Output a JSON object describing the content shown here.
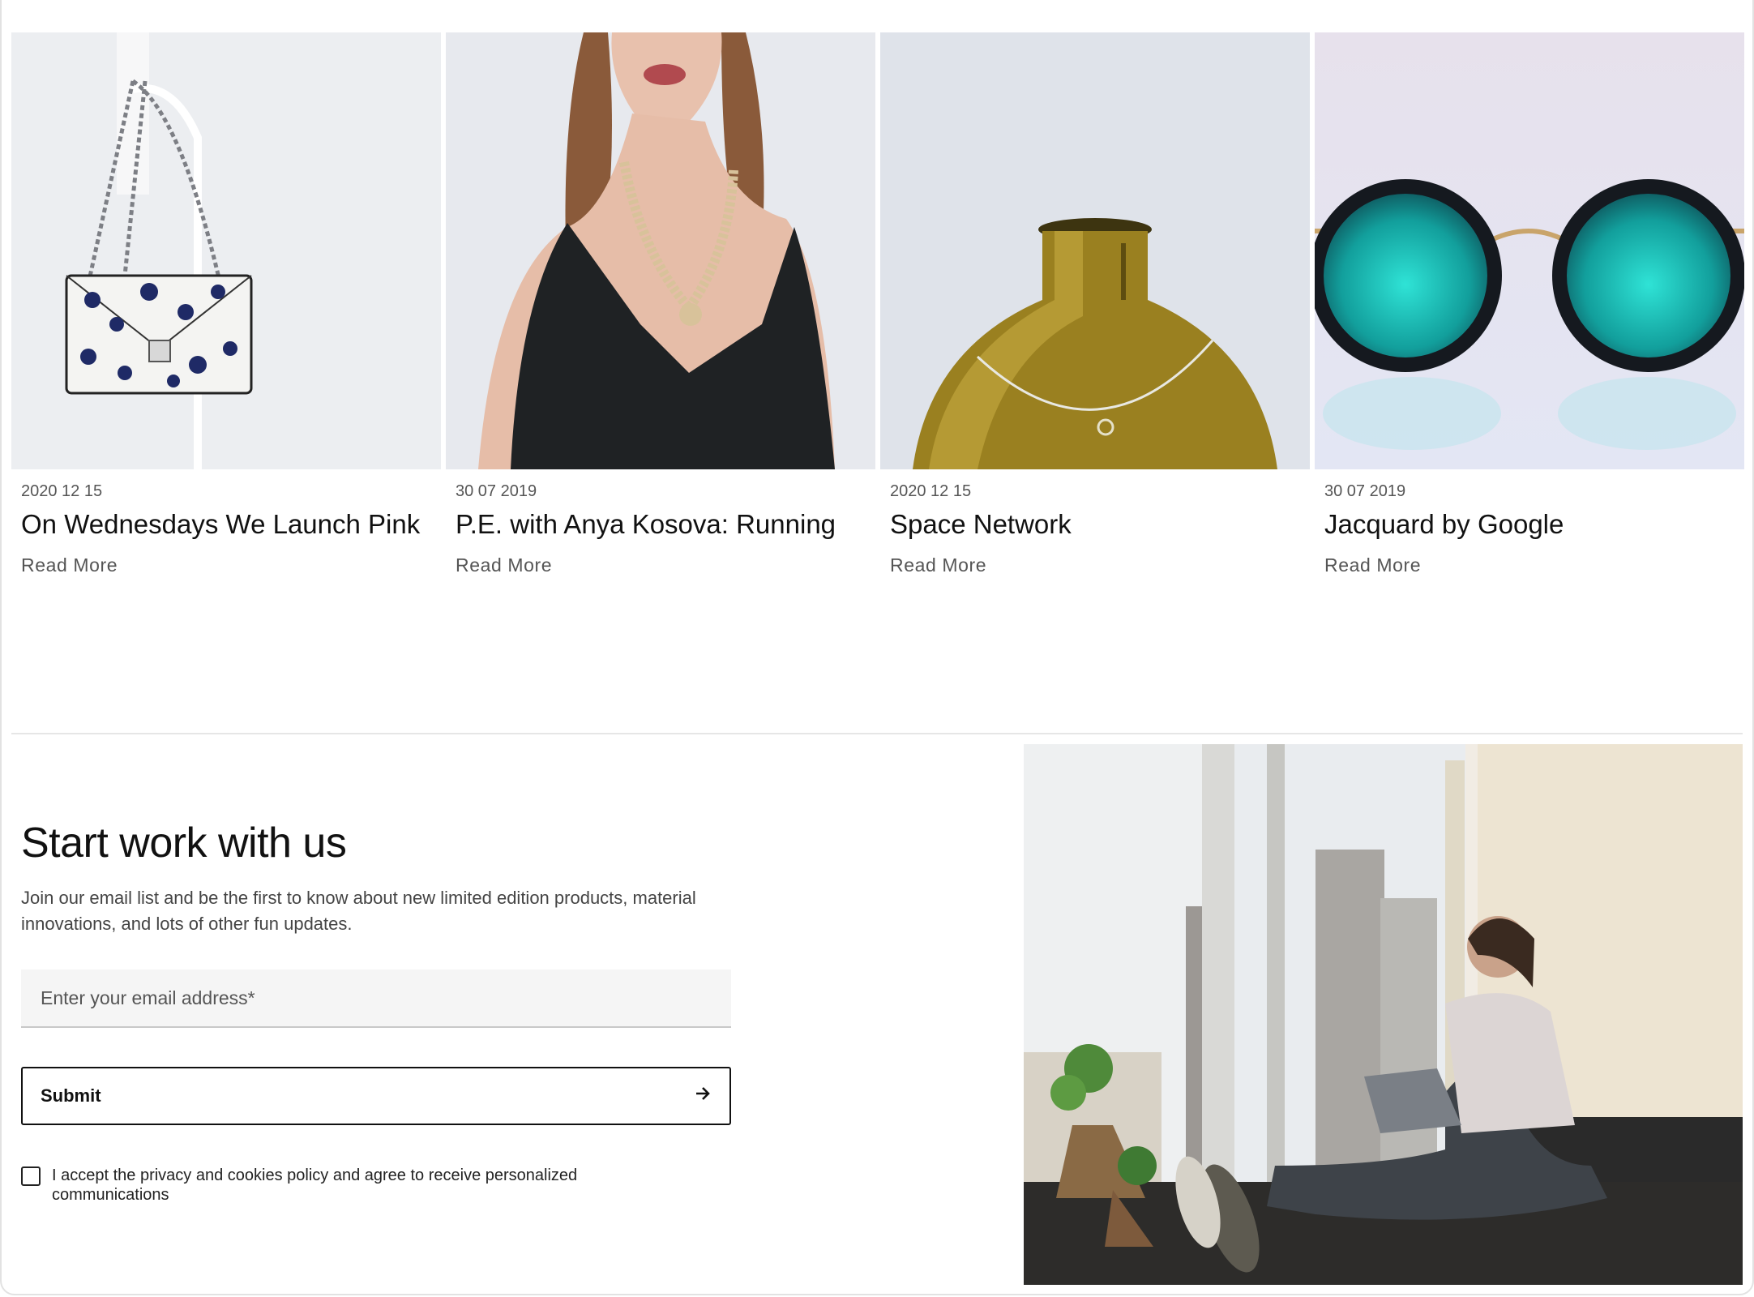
{
  "posts": [
    {
      "date": "2020 12 15",
      "title": "On Wednesdays We Launch Pink",
      "link": "Read More",
      "image": "handbag-photo"
    },
    {
      "date": "30 07 2019",
      "title": "P.E. with Anya Kosova: Running",
      "link": "Read More",
      "image": "necklace-model-photo"
    },
    {
      "date": "2020 12 15",
      "title": "Space Network",
      "link": "Read More",
      "image": "glass-vase-photo"
    },
    {
      "date": "30 07 2019",
      "title": "Jacquard by Google",
      "link": "Read More",
      "image": "sunglasses-photo"
    }
  ],
  "newsletter": {
    "title": "Start work with us",
    "description": "Join our email list and be the first to know about new limited edition products, material innovations, and lots of other fun updates.",
    "email_placeholder": "Enter your email address*",
    "submit_label": "Submit",
    "consent_text": "I accept the privacy and cookies policy and agree to receive personalized communications"
  },
  "colors": {
    "text": "#111111",
    "muted": "#555555",
    "input_bg": "#f5f5f5",
    "divider": "#e6e6e6"
  }
}
